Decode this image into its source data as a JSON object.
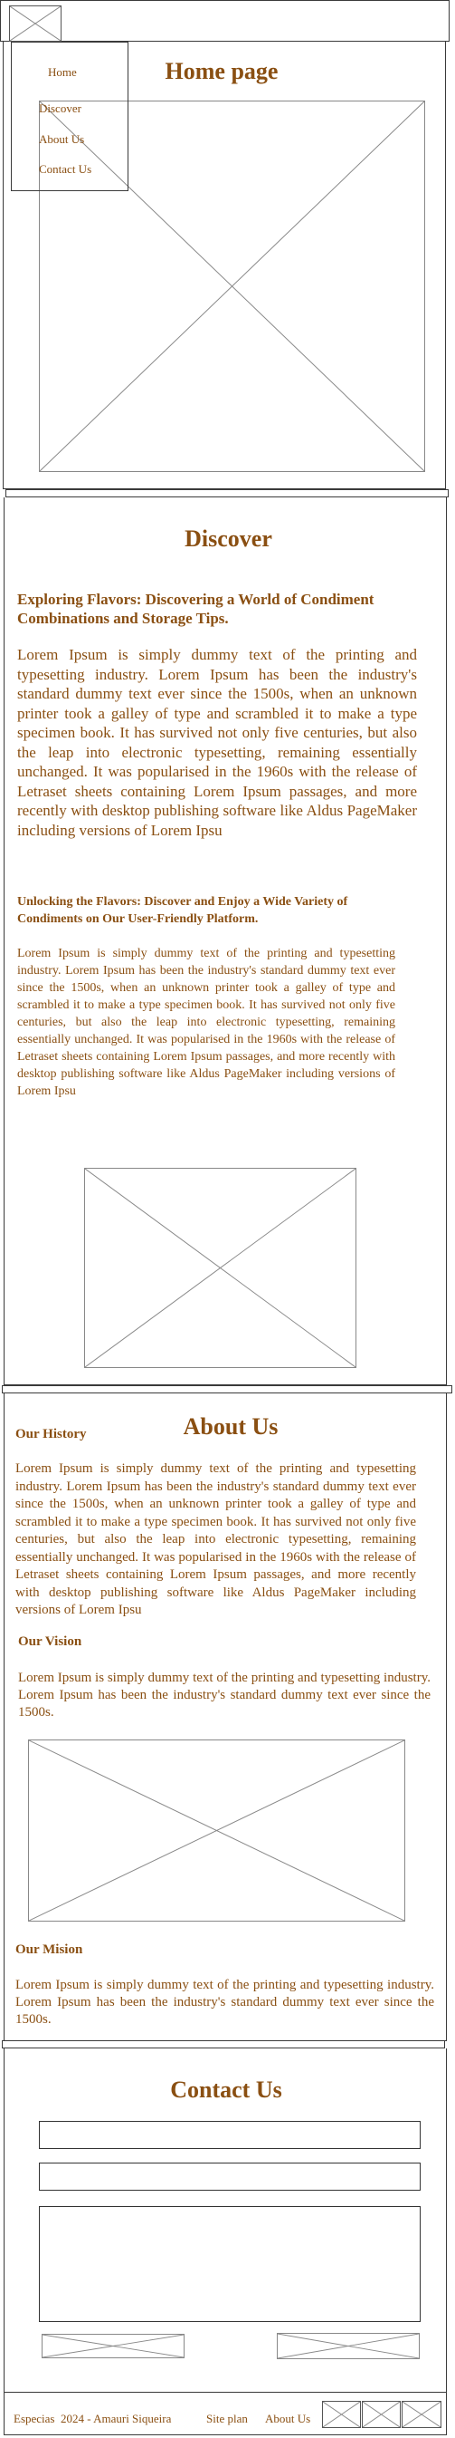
{
  "nav": {
    "items": [
      "Home",
      "Discover",
      "About Us",
      "Contact Us"
    ]
  },
  "home": {
    "title": "Home page"
  },
  "discover": {
    "title": "Discover",
    "subtitle1": "Exploring Flavors: Discovering a World of Condiment Combinations and Storage Tips.",
    "text1": "Lorem Ipsum is simply dummy text of the printing and typesetting industry. Lorem Ipsum has been the industry's standard dummy text ever since the 1500s, when an unknown printer took a galley of type and scrambled it to make a type specimen book. It has survived not only five centuries, but also the leap into electronic typesetting, remaining essentially unchanged. It was popularised in the 1960s with the release of Letraset sheets containing Lorem Ipsum passages, and more recently with desktop publishing software like Aldus PageMaker including versions of Lorem Ipsu",
    "subtitle2": "Unlocking the Flavors: Discover and Enjoy a Wide Variety of Condiments on Our User-Friendly Platform.",
    "text2": "Lorem Ipsum is simply dummy text of the printing and typesetting industry. Lorem Ipsum has been the industry's standard dummy text ever since the 1500s, when an unknown printer took a galley of type and scrambled it to make a type specimen book. It has survived not only five centuries, but also the leap into electronic typesetting, remaining essentially unchanged. It was popularised in the 1960s with the release of Letraset sheets containing Lorem Ipsum passages, and more recently with desktop publishing software like Aldus PageMaker including versions of Lorem Ipsu"
  },
  "about": {
    "title": "About Us",
    "history_title": "Our History",
    "history_text": "Lorem Ipsum is simply dummy text of the printing and typesetting industry. Lorem Ipsum has been the industry's standard dummy text ever since the 1500s, when an unknown printer took a galley of type and scrambled it to make a type specimen book. It has survived not only five centuries, but also the leap into electronic typesetting, remaining essentially unchanged. It was popularised in the 1960s with the release of Letraset sheets containing Lorem Ipsum passages, and more recently with desktop publishing software like Aldus PageMaker including versions of Lorem Ipsu",
    "vision_title": "Our Vision",
    "vision_text": "Lorem Ipsum is simply dummy text of the printing and typesetting industry. Lorem Ipsum has been the industry's standard dummy text ever since the 1500s.",
    "mision_title": "Our Mision",
    "mision_text": "Lorem Ipsum is simply dummy text of the printing and typesetting industry. Lorem Ipsum has been the industry's standard dummy text ever since the 1500s."
  },
  "contact": {
    "title": "Contact Us"
  },
  "footer": {
    "copyright": "Especias  2024 - Amauri Siqueira",
    "site_plan": "Site plan",
    "about": "About Us"
  },
  "colors": {
    "text": "#8a4f12",
    "lines": "#3a3a3a",
    "placeholder": "#888888"
  }
}
